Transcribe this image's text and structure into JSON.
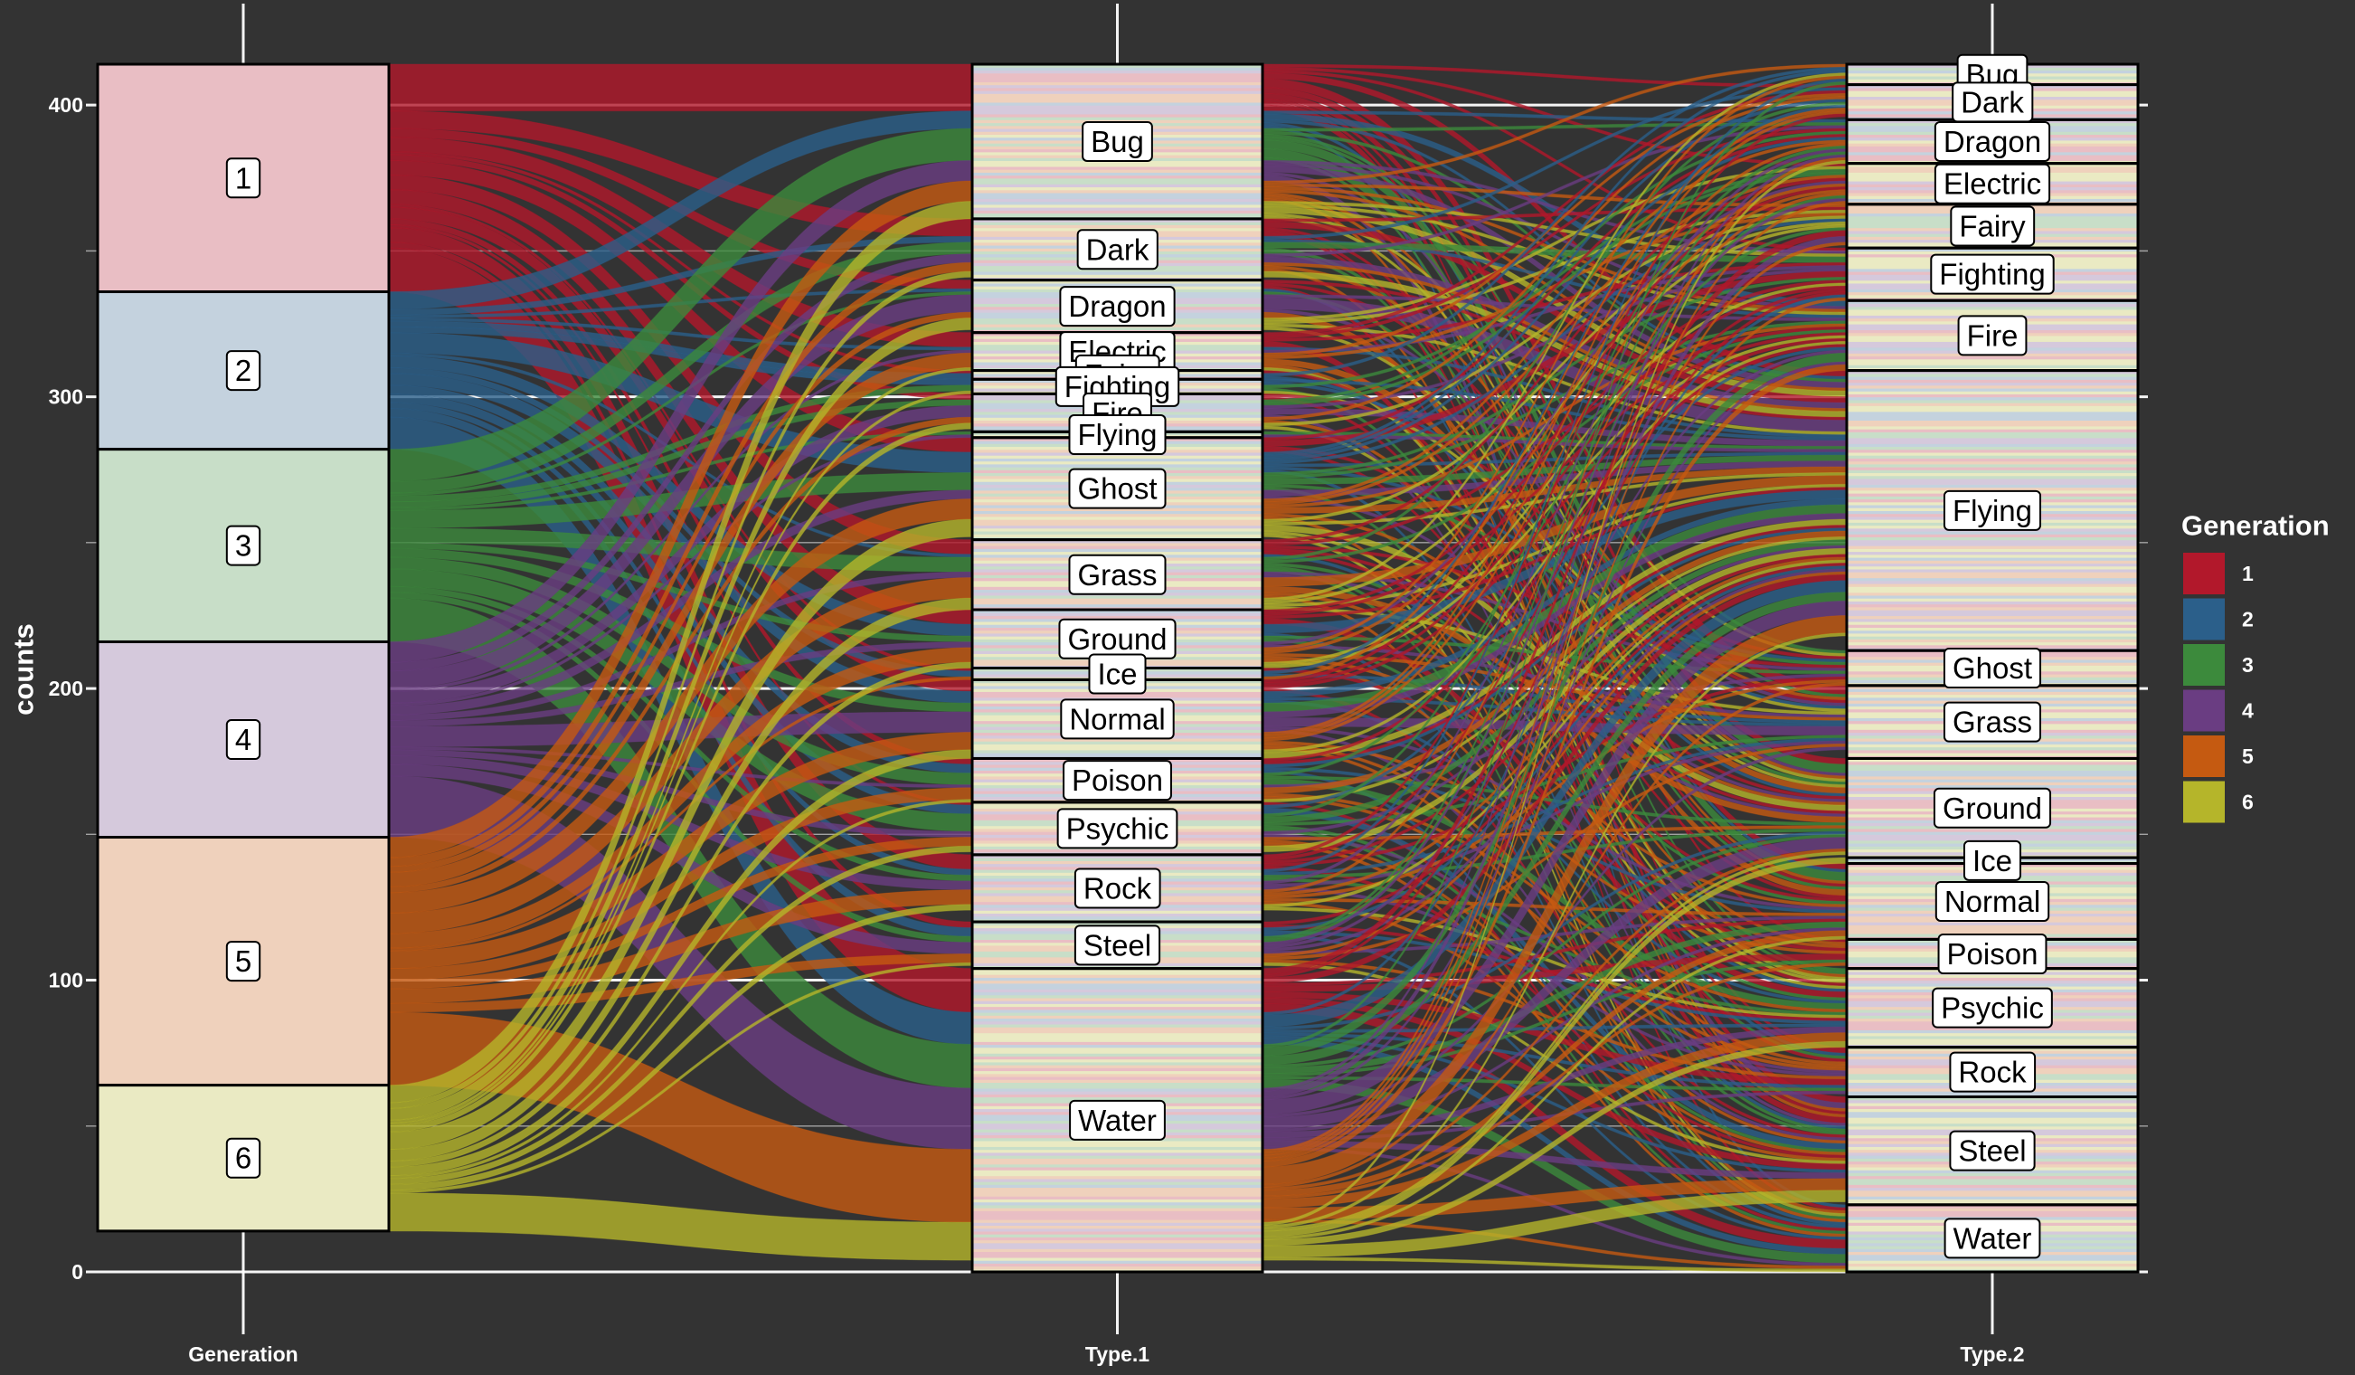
{
  "chart_data": {
    "type": "alluvial",
    "ylabel": "counts",
    "ylim": [
      0,
      414
    ],
    "yticks": [
      0,
      100,
      200,
      300,
      400
    ],
    "axes": [
      "Generation",
      "Type.1",
      "Type.2"
    ],
    "total": 414,
    "legend": {
      "title": "Generation",
      "placement": "right",
      "items": [
        {
          "label": "1",
          "color": "#b2182b"
        },
        {
          "label": "2",
          "color": "#2b5f8a"
        },
        {
          "label": "3",
          "color": "#3c8a3c"
        },
        {
          "label": "4",
          "color": "#6a3d82"
        },
        {
          "label": "5",
          "color": "#c55a11"
        },
        {
          "label": "6",
          "color": "#b5b52a"
        }
      ]
    },
    "strata": {
      "Generation": [
        {
          "label": "1",
          "count": 78
        },
        {
          "label": "2",
          "count": 54
        },
        {
          "label": "3",
          "count": 66
        },
        {
          "label": "4",
          "count": 67
        },
        {
          "label": "5",
          "count": 85
        },
        {
          "label": "6",
          "count": 50
        }
      ],
      "Type.1": [
        {
          "label": "Bug",
          "count": 53
        },
        {
          "label": "Dark",
          "count": 21
        },
        {
          "label": "Dragon",
          "count": 18
        },
        {
          "label": "Electric",
          "count": 13
        },
        {
          "label": "Fairy",
          "count": 3
        },
        {
          "label": "Fighting",
          "count": 5
        },
        {
          "label": "Fire",
          "count": 13
        },
        {
          "label": "Flying",
          "count": 2
        },
        {
          "label": "Ghost",
          "count": 35
        },
        {
          "label": "Grass",
          "count": 24
        },
        {
          "label": "Ground",
          "count": 20
        },
        {
          "label": "Ice",
          "count": 4
        },
        {
          "label": "Normal",
          "count": 27
        },
        {
          "label": "Poison",
          "count": 15
        },
        {
          "label": "Psychic",
          "count": 18
        },
        {
          "label": "Rock",
          "count": 23
        },
        {
          "label": "Steel",
          "count": 16
        },
        {
          "label": "Water",
          "count": 104
        }
      ],
      "Type.2": [
        {
          "label": "Bug",
          "count": 7
        },
        {
          "label": "Dark",
          "count": 12
        },
        {
          "label": "Dragon",
          "count": 15
        },
        {
          "label": "Electric",
          "count": 14
        },
        {
          "label": "Fairy",
          "count": 15
        },
        {
          "label": "Fighting",
          "count": 18
        },
        {
          "label": "Fire",
          "count": 24
        },
        {
          "label": "Flying",
          "count": 96
        },
        {
          "label": "Ghost",
          "count": 12
        },
        {
          "label": "Grass",
          "count": 25
        },
        {
          "label": "Ground",
          "count": 34
        },
        {
          "label": "Ice",
          "count": 2
        },
        {
          "label": "Normal",
          "count": 26
        },
        {
          "label": "Poison",
          "count": 10
        },
        {
          "label": "Psychic",
          "count": 27
        },
        {
          "label": "Rock",
          "count": 17
        },
        {
          "label": "Steel",
          "count": 37
        },
        {
          "label": "Water",
          "count": 23
        }
      ]
    }
  }
}
